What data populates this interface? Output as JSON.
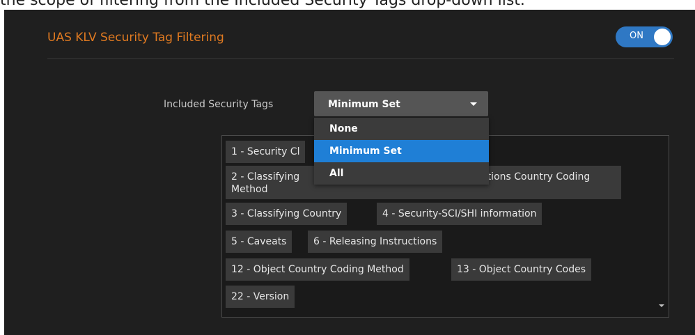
{
  "page": {
    "caption": "the scope of filtering from the Included Security Tags drop-down list."
  },
  "panel": {
    "title": "UAS KLV Security Tag Filtering",
    "toggle_label": "ON"
  },
  "included_tags": {
    "label": "Included Security Tags",
    "selected": "Minimum Set",
    "options": [
      "None",
      "Minimum Set",
      "All"
    ]
  },
  "tags": [
    "1 - Security Cl",
    "2 - Classifying",
    "ctions Country Coding",
    "Method",
    "3 - Classifying Country",
    "4 - Security-SCI/SHI information",
    "5 - Caveats",
    "6 - Releasing Instructions",
    "12 - Object Country Coding Method",
    "13 - Object Country Codes",
    "22 - Version"
  ]
}
